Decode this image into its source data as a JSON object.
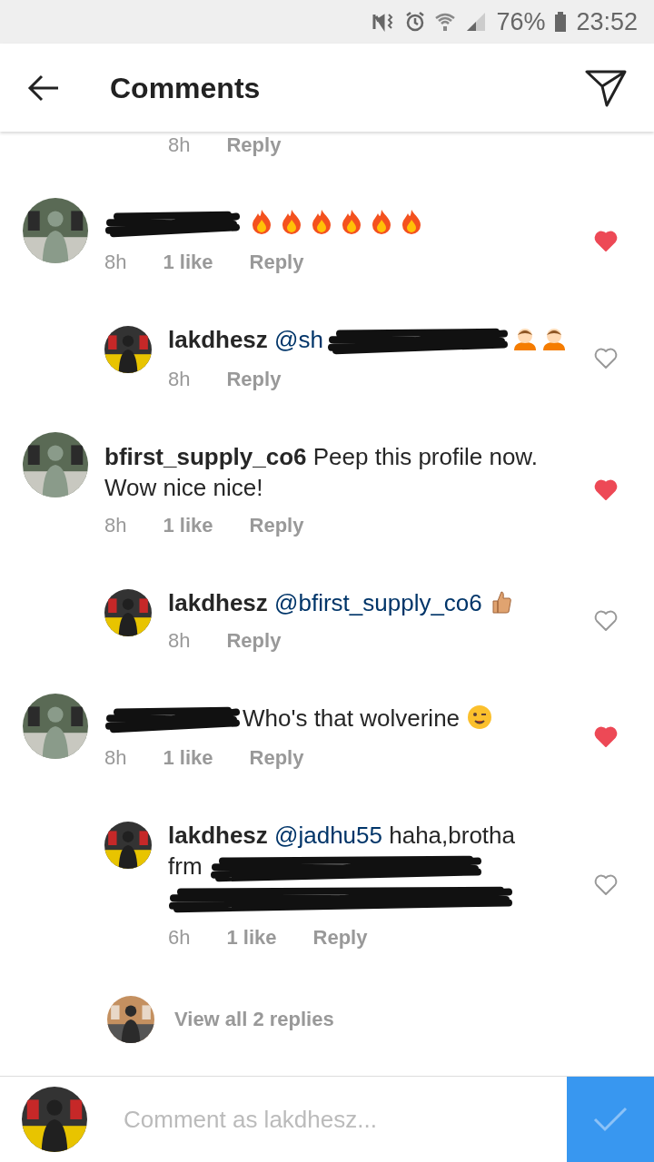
{
  "status_bar": {
    "battery": "76%",
    "time": "23:52"
  },
  "header": {
    "title": "Comments"
  },
  "comments": [
    {
      "kind": "cut",
      "time": "8h",
      "reply": "Reply"
    },
    {
      "kind": "top",
      "emoji": [
        {
          "kind": "fire"
        },
        {
          "kind": "fire"
        },
        {
          "kind": "fire"
        },
        {
          "kind": "fire"
        },
        {
          "kind": "fire"
        },
        {
          "kind": "fire"
        }
      ],
      "scribble": {
        "kind": "name"
      },
      "time": "8h",
      "likes": "1 like",
      "reply": "Reply",
      "liked": true
    },
    {
      "kind": "reply",
      "username": "lakdhesz",
      "text": "@sh",
      "emoji": [
        {
          "kind": "bow"
        },
        {
          "kind": "bow"
        }
      ],
      "scribble": {
        "kind": "mention"
      },
      "time": "8h",
      "reply": "Reply",
      "liked": false
    },
    {
      "kind": "top",
      "username": "bfirst_supply_co6",
      "text": "Peep this profile now. Wow nice nice!",
      "time": "8h",
      "likes": "1 like",
      "reply": "Reply",
      "liked": true
    },
    {
      "kind": "reply",
      "username": "lakdhesz",
      "text": "@bfirst_supply_co6",
      "emoji": [
        {
          "kind": "thumb"
        }
      ],
      "time": "8h",
      "reply": "Reply",
      "liked": false
    },
    {
      "kind": "top",
      "text": "Who's that wolverine",
      "emoji": [
        {
          "kind": "wink"
        }
      ],
      "scribble": {
        "kind": "name"
      },
      "time": "8h",
      "likes": "1 like",
      "reply": "Reply",
      "liked": true
    },
    {
      "kind": "reply",
      "username": "lakdhesz",
      "text": "@jadhu55 haha,brotha frm",
      "scribble": {
        "kind": "body"
      },
      "time": "6h",
      "likes": "1 like",
      "reply": "Reply",
      "liked": false
    }
  ],
  "view_replies": "View all 2 replies",
  "composer": {
    "placeholder": "Comment as lakdhesz..."
  }
}
